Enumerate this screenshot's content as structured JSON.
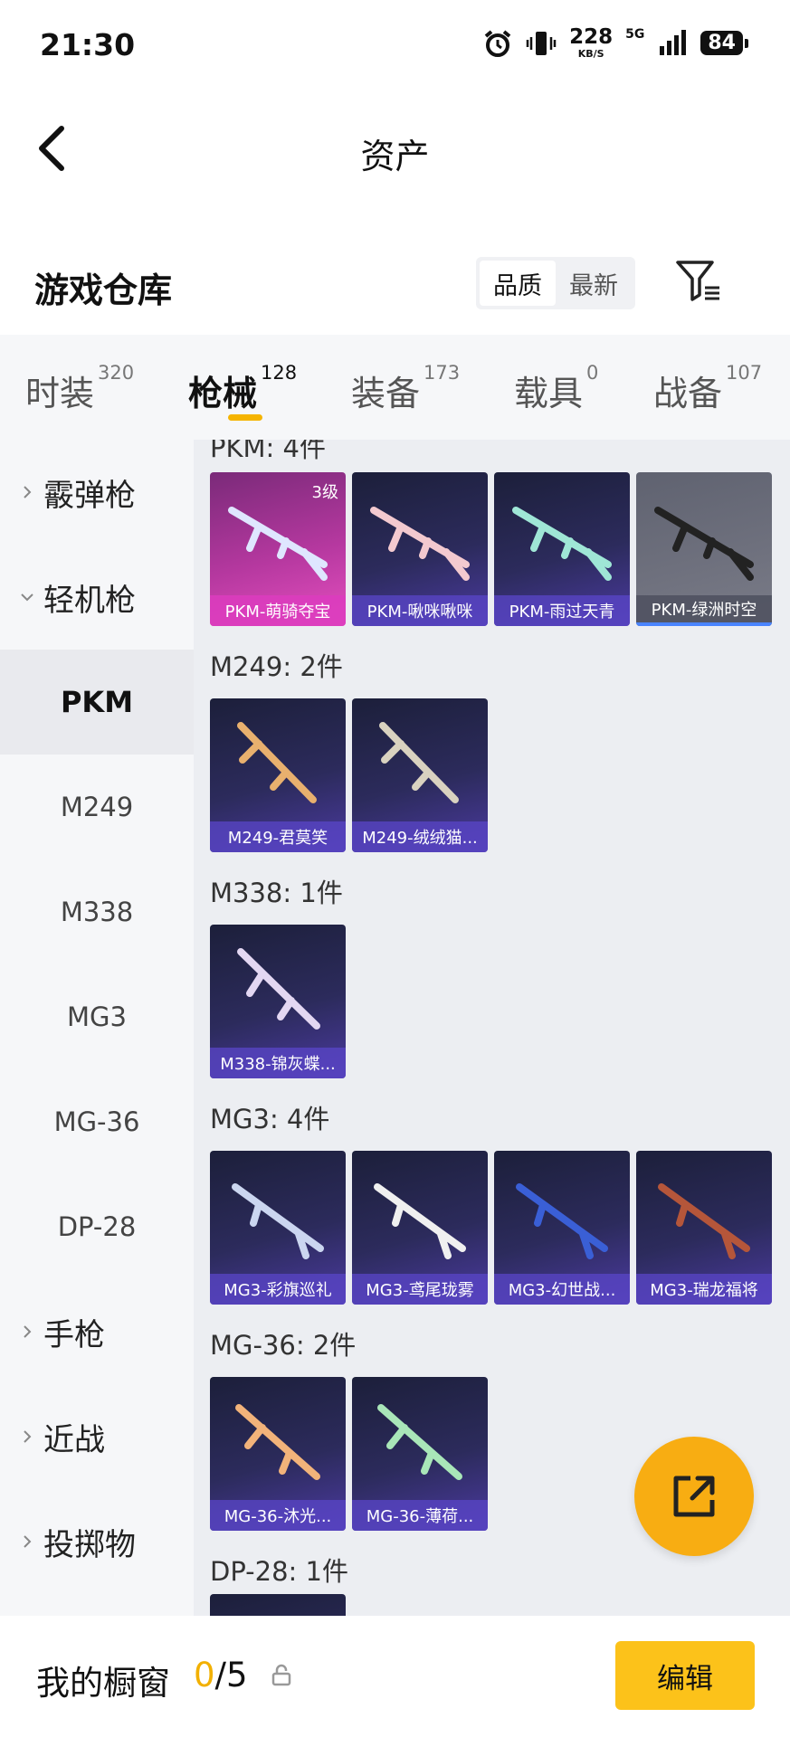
{
  "status_bar": {
    "time": "21:30",
    "net_speed": "228",
    "net_unit": "KB/S",
    "network": "5G",
    "battery": "84"
  },
  "header": {
    "title": "资产"
  },
  "warehouse": {
    "title": "游戏仓库",
    "sort_options": [
      "品质",
      "最新"
    ],
    "active_sort": "品质"
  },
  "tabs": [
    {
      "label": "时装",
      "count": "320"
    },
    {
      "label": "枪械",
      "count": "128",
      "active": true
    },
    {
      "label": "装备",
      "count": "173"
    },
    {
      "label": "载具",
      "count": "0"
    },
    {
      "label": "战备",
      "count": "107"
    }
  ],
  "sidebar": {
    "categories": [
      {
        "label": "霰弹枪",
        "expanded": false
      },
      {
        "label": "轻机枪",
        "expanded": true
      },
      {
        "label": "手枪",
        "expanded": false
      },
      {
        "label": "近战",
        "expanded": false
      },
      {
        "label": "投掷物",
        "expanded": false
      }
    ],
    "subitems": [
      "PKM",
      "M249",
      "M338",
      "MG3",
      "MG-36",
      "DP-28"
    ],
    "active_subitem": "PKM"
  },
  "groups": [
    {
      "title": "PKM: 4件",
      "items": [
        {
          "name": "PKM-萌骑夺宝",
          "level": "3级",
          "style": "pink"
        },
        {
          "name": "PKM-啾咪啾咪",
          "style": "purple"
        },
        {
          "name": "PKM-雨过天青",
          "style": "purple"
        },
        {
          "name": "PKM-绿洲时空",
          "style": "gray"
        }
      ]
    },
    {
      "title": "M249: 2件",
      "items": [
        {
          "name": "M249-君莫笑",
          "style": "purple"
        },
        {
          "name": "M249-绒绒猫...",
          "style": "purple"
        }
      ]
    },
    {
      "title": "M338: 1件",
      "items": [
        {
          "name": "M338-锦灰蝶...",
          "style": "purple"
        }
      ]
    },
    {
      "title": "MG3: 4件",
      "items": [
        {
          "name": "MG3-彩旗巡礼",
          "style": "purple"
        },
        {
          "name": "MG3-鸢尾珑雾",
          "style": "purple"
        },
        {
          "name": "MG3-幻世战...",
          "style": "purple"
        },
        {
          "name": "MG3-瑞龙福将",
          "style": "purple"
        }
      ]
    },
    {
      "title": "MG-36: 2件",
      "items": [
        {
          "name": "MG-36-沐光...",
          "style": "purple"
        },
        {
          "name": "MG-36-薄荷...",
          "style": "purple"
        }
      ]
    },
    {
      "title": "DP-28: 1件",
      "items": [
        {
          "name": "",
          "style": "purple"
        }
      ]
    }
  ],
  "bottom_bar": {
    "label": "我的橱窗",
    "current": "0",
    "total": "/5",
    "edit_label": "编辑"
  },
  "icons": {
    "back": "back-arrow-icon",
    "filter": "filter-icon",
    "share": "share-external-icon",
    "lock": "lock-icon",
    "alarm": "alarm-icon",
    "vibrate": "vibrate-icon",
    "signal": "signal-icon"
  },
  "colors": {
    "accent": "#fcc21a",
    "tab_indicator": "#f5b400",
    "card_purple": "#2c2b5c",
    "card_pink": "#e54fbf"
  }
}
